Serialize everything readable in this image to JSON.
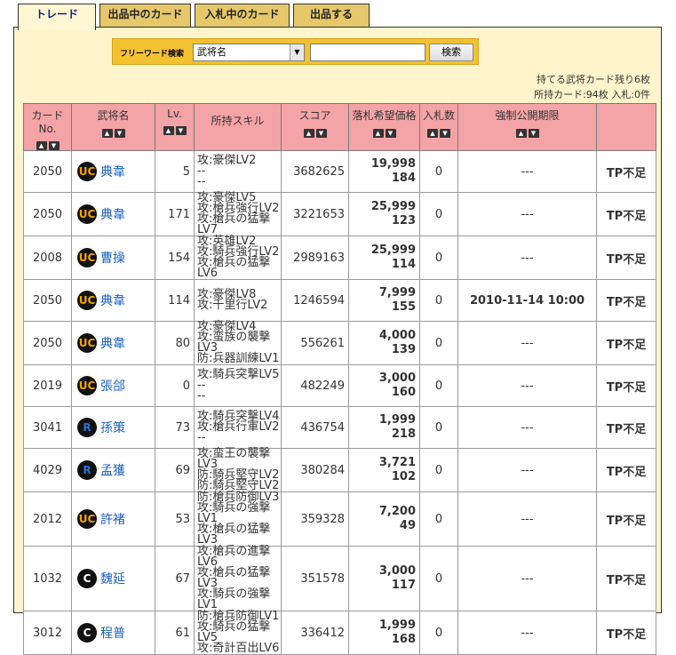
{
  "tabs": [
    {
      "label": "トレード"
    },
    {
      "label": "出品中のカード"
    },
    {
      "label": "入札中のカード"
    },
    {
      "label": "出品する"
    }
  ],
  "search": {
    "label": "フリーワード検索",
    "select_value": "武将名",
    "input_value": "",
    "button_label": "検索"
  },
  "info": {
    "line1": "持てる武将カード残り6枚",
    "line2": "所持カード:94枚 入札:0件"
  },
  "columns": [
    "カードNo.",
    "武将名",
    "Lv.",
    "所持スキル",
    "スコア",
    "落札希望価格",
    "入札数",
    "強制公開期限",
    ""
  ],
  "sort_icons": {
    "up": "▲",
    "down": "▼"
  },
  "rows": [
    {
      "no": "2050",
      "rarity": "UC",
      "name": "典韋",
      "lv": "5",
      "skills": [
        "攻:豪傑LV2",
        "--",
        "--"
      ],
      "score": "3682625",
      "price": "19,998",
      "sub": "184",
      "bids": "0",
      "deadline": "---",
      "action": "TP不足"
    },
    {
      "no": "2050",
      "rarity": "UC",
      "name": "典韋",
      "lv": "171",
      "skills": [
        "攻:豪傑LV5",
        "攻:槍兵強行LV2",
        "攻:槍兵の猛撃LV7"
      ],
      "score": "3221653",
      "price": "25,999",
      "sub": "123",
      "bids": "0",
      "deadline": "---",
      "action": "TP不足"
    },
    {
      "no": "2008",
      "rarity": "UC",
      "name": "曹操",
      "lv": "154",
      "skills": [
        "攻:英雄LV2",
        "攻:騎兵強行LV2",
        "攻:槍兵の猛撃LV6"
      ],
      "score": "2989163",
      "price": "25,999",
      "sub": "114",
      "bids": "0",
      "deadline": "---",
      "action": "TP不足"
    },
    {
      "no": "2050",
      "rarity": "UC",
      "name": "典韋",
      "lv": "114",
      "skills": [
        "攻:豪傑LV8",
        "攻:千里行LV2",
        ""
      ],
      "score": "1246594",
      "price": "7,999",
      "sub": "155",
      "bids": "0",
      "deadline": "2010-11-14 10:00",
      "action": "TP不足"
    },
    {
      "no": "2050",
      "rarity": "UC",
      "name": "典韋",
      "lv": "80",
      "skills": [
        "攻:豪傑LV4",
        "攻:蛮族の襲撃LV3",
        "防:兵器訓練LV1"
      ],
      "score": "556261",
      "price": "4,000",
      "sub": "139",
      "bids": "0",
      "deadline": "---",
      "action": "TP不足"
    },
    {
      "no": "2019",
      "rarity": "UC",
      "name": "張郃",
      "lv": "0",
      "skills": [
        "攻:騎兵突撃LV5",
        "--",
        "--"
      ],
      "score": "482249",
      "price": "3,000",
      "sub": "160",
      "bids": "0",
      "deadline": "---",
      "action": "TP不足"
    },
    {
      "no": "3041",
      "rarity": "R",
      "name": "孫策",
      "lv": "73",
      "skills": [
        "攻:騎兵突撃LV4",
        "攻:槍兵行軍LV2",
        "--"
      ],
      "score": "436754",
      "price": "1,999",
      "sub": "218",
      "bids": "0",
      "deadline": "---",
      "action": "TP不足"
    },
    {
      "no": "4029",
      "rarity": "R",
      "name": "孟獲",
      "lv": "69",
      "skills": [
        "攻:蛮王の襲撃LV3",
        "防:騎兵堅守LV2",
        "防:騎兵堅守LV2"
      ],
      "score": "380284",
      "price": "3,721",
      "sub": "102",
      "bids": "0",
      "deadline": "---",
      "action": "TP不足"
    },
    {
      "no": "2012",
      "rarity": "UC",
      "name": "許褚",
      "lv": "53",
      "skills": [
        "防:槍兵防御LV3",
        "攻:騎兵の強撃LV1",
        "攻:槍兵の猛撃LV3"
      ],
      "score": "359328",
      "price": "7,200",
      "sub": "49",
      "bids": "0",
      "deadline": "---",
      "action": "TP不足"
    },
    {
      "no": "1032",
      "rarity": "C",
      "name": "魏延",
      "lv": "67",
      "skills": [
        "攻:槍兵の進撃LV6",
        "攻:槍兵の猛撃LV3",
        "攻:騎兵の強撃LV1"
      ],
      "score": "351578",
      "price": "3,000",
      "sub": "117",
      "bids": "0",
      "deadline": "---",
      "action": "TP不足"
    },
    {
      "no": "3012",
      "rarity": "C",
      "name": "程普",
      "lv": "61",
      "skills": [
        "防:槍兵防御LV1",
        "攻:騎兵の猛撃LV5",
        "攻:奇計百出LV6"
      ],
      "score": "336412",
      "price": "1,999",
      "sub": "168",
      "bids": "0",
      "deadline": "---",
      "action": "TP不足"
    }
  ]
}
